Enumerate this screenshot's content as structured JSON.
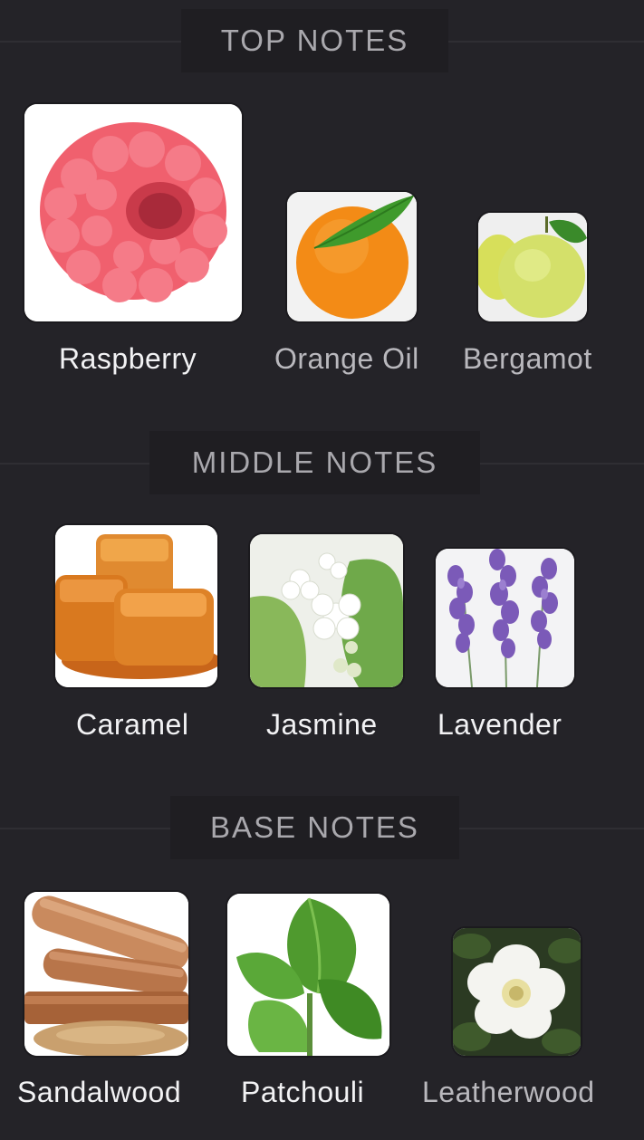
{
  "sections": [
    {
      "title": "TOP NOTES",
      "notes": [
        {
          "name": "Raspberry",
          "icon": "raspberry-image",
          "emphasis": "primary"
        },
        {
          "name": "Orange Oil",
          "icon": "orange-image",
          "emphasis": "secondary"
        },
        {
          "name": "Bergamot",
          "icon": "bergamot-image",
          "emphasis": "secondary"
        }
      ]
    },
    {
      "title": "MIDDLE NOTES",
      "notes": [
        {
          "name": "Caramel",
          "icon": "caramel-image",
          "emphasis": "primary"
        },
        {
          "name": "Jasmine",
          "icon": "jasmine-image",
          "emphasis": "primary"
        },
        {
          "name": "Lavender",
          "icon": "lavender-image",
          "emphasis": "primary"
        }
      ]
    },
    {
      "title": "BASE NOTES",
      "notes": [
        {
          "name": "Sandalwood",
          "icon": "sandalwood-image",
          "emphasis": "primary"
        },
        {
          "name": "Patchouli",
          "icon": "patchouli-image",
          "emphasis": "primary"
        },
        {
          "name": "Leatherwood",
          "icon": "leatherwood-image",
          "emphasis": "secondary"
        }
      ]
    }
  ],
  "colors": {
    "background": "#242328",
    "header_pill": "#1f1e22",
    "header_text": "#a9a8ad",
    "label_primary": "#f2f2f4",
    "label_secondary": "#b9b8bd"
  }
}
